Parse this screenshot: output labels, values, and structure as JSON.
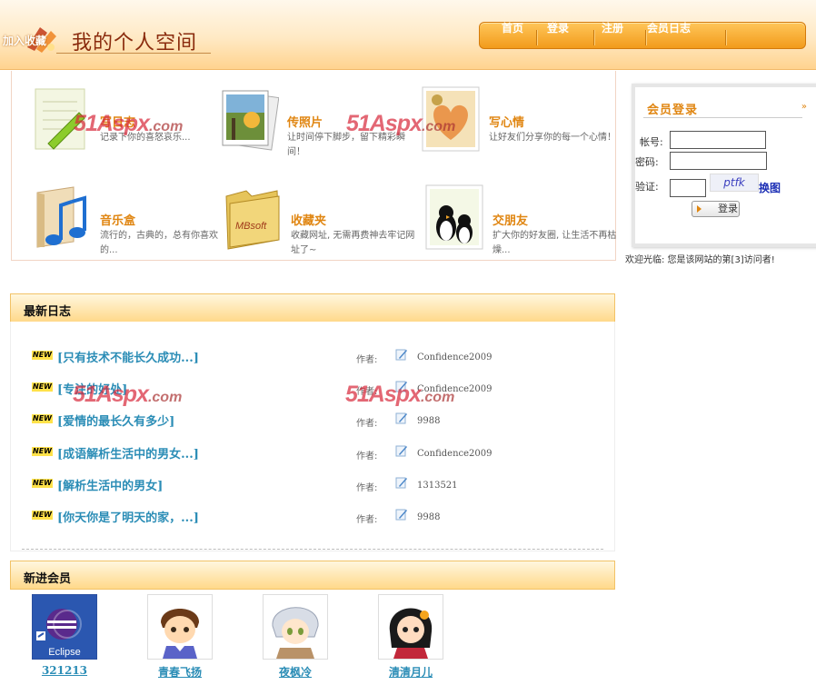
{
  "header": {
    "favorite_link": "加入收藏",
    "site_title": "我的个人空间",
    "nav": [
      "首页",
      "登录",
      "注册",
      "会员日志"
    ]
  },
  "features": [
    {
      "title": "写日志",
      "desc": "记录下你的喜怒哀乐..."
    },
    {
      "title": "传照片",
      "desc": "让时间停下脚步，留下精彩瞬间！"
    },
    {
      "title": "写心情",
      "desc": "让好友们分享你的每一个心情！"
    },
    {
      "title": "音乐盒",
      "desc": "流行的，古典的，总有你喜欢的..."
    },
    {
      "title": "收藏夹",
      "desc": "收藏网址, 无需再费神去牢记网址了~"
    },
    {
      "title": "交朋友",
      "desc": "扩大你的好友圈, 让生活不再枯燥..."
    }
  ],
  "watermark": {
    "main": "51Aspx",
    "suffix": ".com"
  },
  "login": {
    "title": "会员登录",
    "arrow": "»",
    "account_label": "帐号:",
    "password_label": "密码:",
    "verify_label": "验证:",
    "captcha_text": "ptfk",
    "refresh_label": "换图",
    "submit_label": "登录"
  },
  "visitor_text": "欢迎光临: 您是该网站的第[3]访问者!",
  "latest_blogs": {
    "heading": "最新日志",
    "badge": "NEW",
    "author_label": "作者:",
    "items": [
      {
        "title": "[只有技术不能长久成功...]",
        "author": "Confidence2009"
      },
      {
        "title": "[专注的好处]",
        "author": "Confidence2009"
      },
      {
        "title": "[爱情的最长久有多少]",
        "author": "9988"
      },
      {
        "title": "[成语解析生活中的男女...]",
        "author": "Confidence2009"
      },
      {
        "title": "[解析生活中的男女]",
        "author": "1313521"
      },
      {
        "title": "[你天你是了明天的家，...]",
        "author": "9988"
      }
    ]
  },
  "new_members": {
    "heading": "新进会员",
    "avatar_caption": "Eclipse",
    "items": [
      {
        "name": "321213"
      },
      {
        "name": "青春飞扬"
      },
      {
        "name": "夜枫冷"
      },
      {
        "name": "清清月儿"
      }
    ]
  },
  "colors": {
    "accent": "#e08612",
    "link": "#2b8db6",
    "nav": "#f29b1b"
  }
}
